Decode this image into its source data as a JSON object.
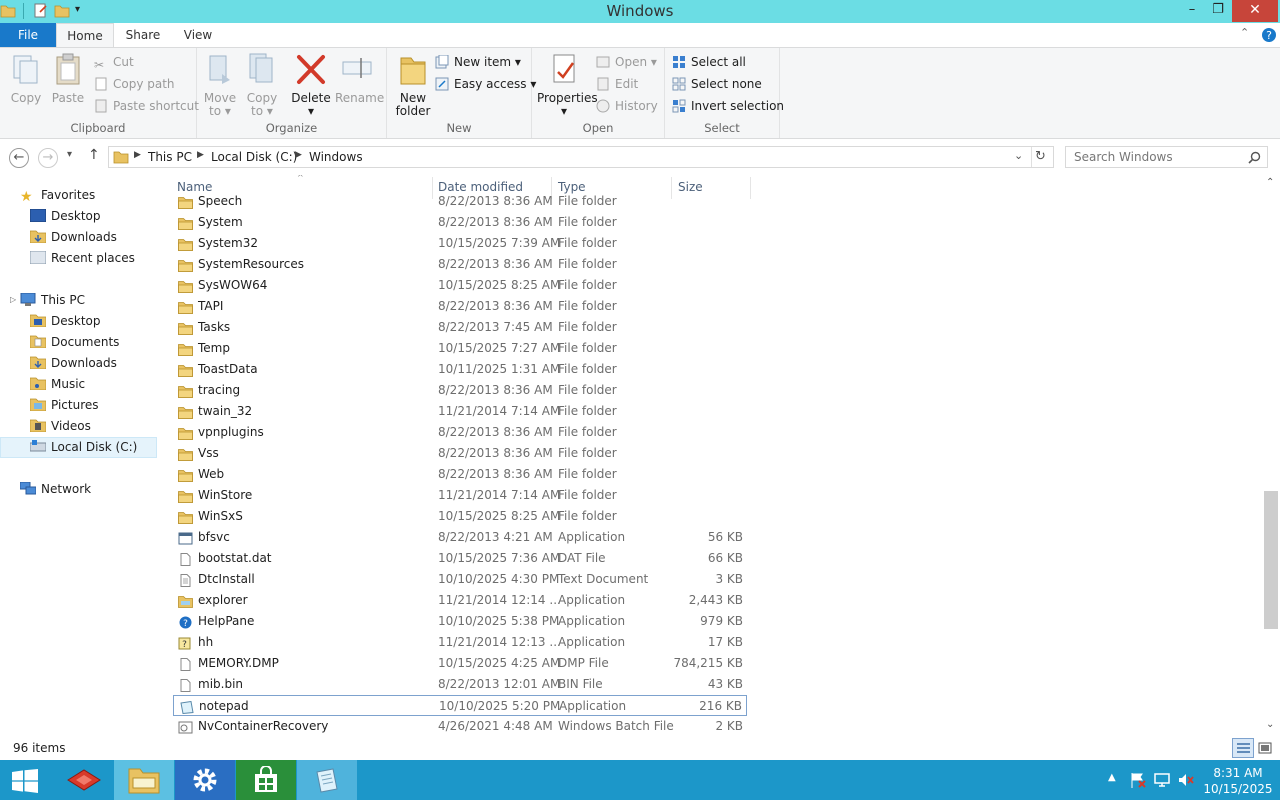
{
  "window": {
    "title": "Windows"
  },
  "tabs": {
    "file": "File",
    "home": "Home",
    "share": "Share",
    "view": "View"
  },
  "ribbon": {
    "clipboard": {
      "copy": "Copy",
      "paste": "Paste",
      "cut": "Cut",
      "copy_path": "Copy path",
      "paste_shortcut": "Paste shortcut",
      "label": "Clipboard"
    },
    "organize": {
      "move_to": "Move",
      "move_to2": "to",
      "copy_to": "Copy",
      "copy_to2": "to",
      "delete": "Delete",
      "rename": "Rename",
      "label": "Organize"
    },
    "new": {
      "new_folder": "New",
      "new_folder2": "folder",
      "new_item": "New item",
      "easy_access": "Easy access",
      "label": "New"
    },
    "open": {
      "properties": "Properties",
      "open": "Open",
      "edit": "Edit",
      "history": "History",
      "label": "Open"
    },
    "select": {
      "select_all": "Select all",
      "select_none": "Select none",
      "invert": "Invert selection",
      "label": "Select"
    }
  },
  "address": {
    "crumbs": [
      "This PC",
      "Local Disk (C:)",
      "Windows"
    ],
    "search_placeholder": "Search Windows"
  },
  "nav": {
    "favorites": "Favorites",
    "fav_items": [
      "Desktop",
      "Downloads",
      "Recent places"
    ],
    "this_pc": "This PC",
    "pc_items": [
      "Desktop",
      "Documents",
      "Downloads",
      "Music",
      "Pictures",
      "Videos",
      "Local Disk (C:)"
    ],
    "network": "Network"
  },
  "columns": {
    "name": "Name",
    "date": "Date modified",
    "type": "Type",
    "size": "Size"
  },
  "files": [
    {
      "name": "Speech",
      "date": "8/22/2013 8:36 AM",
      "type": "File folder",
      "size": "",
      "kind": "folder"
    },
    {
      "name": "System",
      "date": "8/22/2013 8:36 AM",
      "type": "File folder",
      "size": "",
      "kind": "folder"
    },
    {
      "name": "System32",
      "date": "10/15/2025 7:39 AM",
      "type": "File folder",
      "size": "",
      "kind": "folder"
    },
    {
      "name": "SystemResources",
      "date": "8/22/2013 8:36 AM",
      "type": "File folder",
      "size": "",
      "kind": "folder"
    },
    {
      "name": "SysWOW64",
      "date": "10/15/2025 8:25 AM",
      "type": "File folder",
      "size": "",
      "kind": "folder"
    },
    {
      "name": "TAPI",
      "date": "8/22/2013 8:36 AM",
      "type": "File folder",
      "size": "",
      "kind": "folder"
    },
    {
      "name": "Tasks",
      "date": "8/22/2013 7:45 AM",
      "type": "File folder",
      "size": "",
      "kind": "folder"
    },
    {
      "name": "Temp",
      "date": "10/15/2025 7:27 AM",
      "type": "File folder",
      "size": "",
      "kind": "folder"
    },
    {
      "name": "ToastData",
      "date": "10/11/2025 1:31 AM",
      "type": "File folder",
      "size": "",
      "kind": "folder"
    },
    {
      "name": "tracing",
      "date": "8/22/2013 8:36 AM",
      "type": "File folder",
      "size": "",
      "kind": "folder"
    },
    {
      "name": "twain_32",
      "date": "11/21/2014 7:14 AM",
      "type": "File folder",
      "size": "",
      "kind": "folder"
    },
    {
      "name": "vpnplugins",
      "date": "8/22/2013 8:36 AM",
      "type": "File folder",
      "size": "",
      "kind": "folder"
    },
    {
      "name": "Vss",
      "date": "8/22/2013 8:36 AM",
      "type": "File folder",
      "size": "",
      "kind": "folder"
    },
    {
      "name": "Web",
      "date": "8/22/2013 8:36 AM",
      "type": "File folder",
      "size": "",
      "kind": "folder"
    },
    {
      "name": "WinStore",
      "date": "11/21/2014 7:14 AM",
      "type": "File folder",
      "size": "",
      "kind": "folder"
    },
    {
      "name": "WinSxS",
      "date": "10/15/2025 8:25 AM",
      "type": "File folder",
      "size": "",
      "kind": "folder"
    },
    {
      "name": "bfsvc",
      "date": "8/22/2013 4:21 AM",
      "type": "Application",
      "size": "56 KB",
      "kind": "app"
    },
    {
      "name": "bootstat.dat",
      "date": "10/15/2025 7:36 AM",
      "type": "DAT File",
      "size": "66 KB",
      "kind": "file"
    },
    {
      "name": "DtcInstall",
      "date": "10/10/2025 4:30 PM",
      "type": "Text Document",
      "size": "3 KB",
      "kind": "text"
    },
    {
      "name": "explorer",
      "date": "11/21/2014 12:14 ...",
      "type": "Application",
      "size": "2,443 KB",
      "kind": "explorer"
    },
    {
      "name": "HelpPane",
      "date": "10/10/2025 5:38 PM",
      "type": "Application",
      "size": "979 KB",
      "kind": "help"
    },
    {
      "name": "hh",
      "date": "11/21/2014 12:13 ...",
      "type": "Application",
      "size": "17 KB",
      "kind": "hh"
    },
    {
      "name": "MEMORY.DMP",
      "date": "10/15/2025 4:25 AM",
      "type": "DMP File",
      "size": "784,215 KB",
      "kind": "file"
    },
    {
      "name": "mib.bin",
      "date": "8/22/2013 12:01 AM",
      "type": "BIN File",
      "size": "43 KB",
      "kind": "file"
    },
    {
      "name": "notepad",
      "date": "10/10/2025 5:20 PM",
      "type": "Application",
      "size": "216 KB",
      "kind": "notepad",
      "selected": true
    },
    {
      "name": "NvContainerRecovery",
      "date": "4/26/2021 4:48 AM",
      "type": "Windows Batch File",
      "size": "2 KB",
      "kind": "batch"
    }
  ],
  "status": {
    "count": "96 items"
  },
  "clock": {
    "time": "8:31 AM",
    "date": "10/15/2025"
  },
  "colors": {
    "titlebar": "#6bdde4",
    "file_tab": "#1979ca",
    "taskbar": "#1c97c9",
    "close": "#c7453a",
    "folder": "#e8c262"
  }
}
